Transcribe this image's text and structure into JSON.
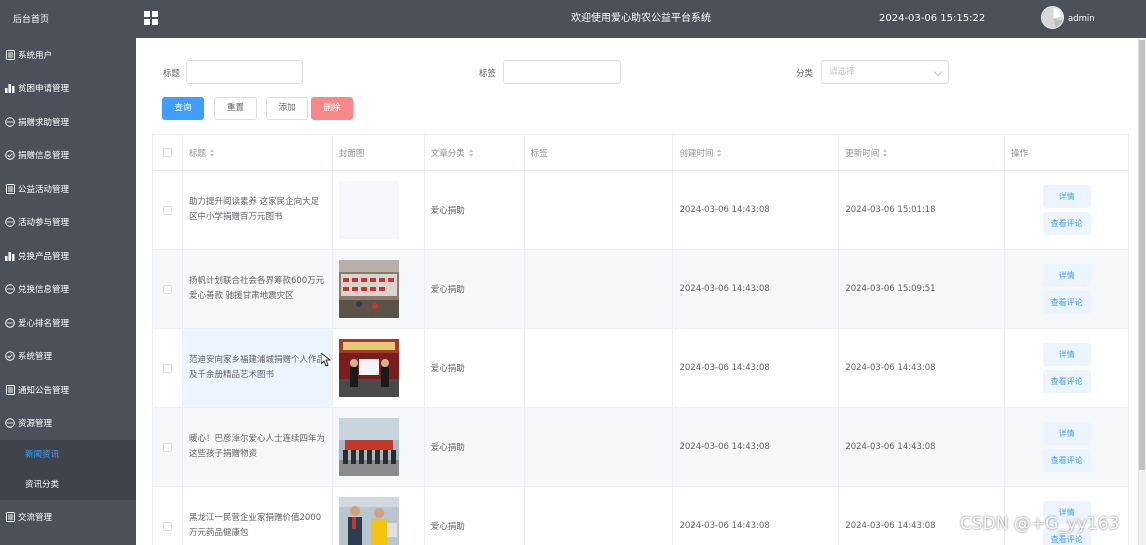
{
  "sidebar": {
    "brand": "后台首页",
    "items": [
      {
        "label": "系统用户",
        "icon": "doc-icon"
      },
      {
        "label": "贫困申请管理",
        "icon": "chart-icon"
      },
      {
        "label": "捐赠求助管理",
        "icon": "chat-icon"
      },
      {
        "label": "捐赠信息管理",
        "icon": "check-circle-icon"
      },
      {
        "label": "公益活动管理",
        "icon": "doc-icon"
      },
      {
        "label": "活动参与管理",
        "icon": "chat-icon"
      },
      {
        "label": "兑换产品管理",
        "icon": "chart-icon"
      },
      {
        "label": "兑换信息管理",
        "icon": "chat-icon"
      },
      {
        "label": "爱心排名管理",
        "icon": "chat-icon"
      },
      {
        "label": "系统管理",
        "icon": "check-circle-icon"
      },
      {
        "label": "通知公告管理",
        "icon": "doc-icon"
      },
      {
        "label": "资源管理",
        "icon": "chat-icon"
      }
    ],
    "subitems": [
      {
        "label": "新闻资讯",
        "active": true
      },
      {
        "label": "资讯分类",
        "active": false
      }
    ],
    "after": {
      "label": "交流管理",
      "icon": "doc-icon"
    }
  },
  "header": {
    "title": "欢迎使用爱心助农公益平台系统",
    "datetime": "2024-03-06 15:15:22",
    "username": "admin"
  },
  "search": {
    "title_label": "标题",
    "title_value": "",
    "tag_label": "标签",
    "tag_value": "",
    "category_label": "分类",
    "category_placeholder": "请选择"
  },
  "actions": {
    "query": "查询",
    "reset": "重置",
    "add": "添加",
    "delete": "删除"
  },
  "table": {
    "columns": [
      "标题",
      "封面图",
      "文章分类",
      "标签",
      "创建时间",
      "更新时间",
      "操作"
    ],
    "rows": [
      {
        "title": "助力提升阅读素养 这家民企向大足区中小学捐赠百万元图书",
        "cover": "blank",
        "category": "爱心捐助",
        "tag": "",
        "created": "2024-03-06 14:43:08",
        "updated": "2024-03-06 15:01:18"
      },
      {
        "title": "扬帆计划联合社会各界筹款600万元爱心善款 驰援甘肃地震灾区",
        "cover": "boxes",
        "category": "爱心捐助",
        "tag": "",
        "created": "2024-03-06 14:43:08",
        "updated": "2024-03-06 15:09:51"
      },
      {
        "title": "范迪安向家乡福建浦城捐赠个人作品及千余册精品艺术图书",
        "cover": "ceremony",
        "category": "爱心捐助",
        "tag": "",
        "created": "2024-03-06 14:43:08",
        "updated": "2024-03-06 14:43:08"
      },
      {
        "title": "暖心！巴彦淖尔爱心人士连续四年为这些孩子捐赠物资",
        "cover": "group",
        "category": "爱心捐助",
        "tag": "",
        "created": "2024-03-06 14:43:08",
        "updated": "2024-03-06 14:43:08"
      },
      {
        "title": "黑龙江一民营企业家捐赠价值2000万元药品健康包",
        "cover": "people",
        "category": "爱心捐助",
        "tag": "",
        "created": "2024-03-06 14:43:08",
        "updated": "2024-03-06 14:43:08"
      }
    ],
    "op_detail": "详情",
    "op_comments": "查看评论"
  },
  "watermark": "CSDN @+G_yy163",
  "colors": {
    "sidebar_bg": "#4b5059",
    "primary": "#409eff",
    "danger": "#f78989"
  }
}
